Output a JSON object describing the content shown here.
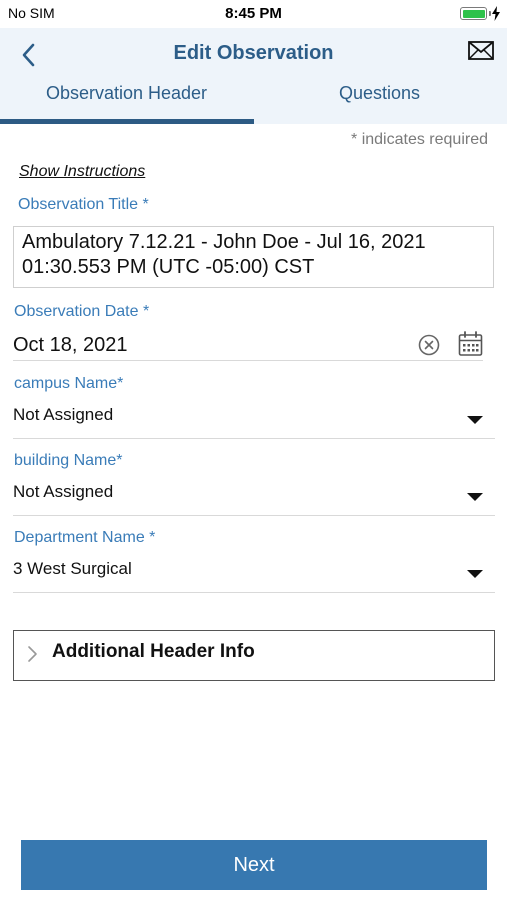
{
  "status_bar": {
    "carrier": "No SIM",
    "time": "8:45 PM",
    "battery_level": 1.0
  },
  "nav": {
    "title": "Edit Observation",
    "back_icon": "chevron-left-icon",
    "mail_icon": "envelope-icon"
  },
  "tabs": [
    {
      "label": "Observation Header",
      "active": true
    },
    {
      "label": "Questions",
      "active": false
    }
  ],
  "required_note": "* indicates required",
  "show_instructions": "Show Instructions",
  "fields": {
    "observation_title": {
      "label": "Observation Title *",
      "value": "Ambulatory 7.12.21 - John Doe - Jul 16, 2021 01:30.553 PM (UTC -05:00) CST"
    },
    "observation_date": {
      "label": "Observation Date *",
      "value": "Oct 18, 2021"
    },
    "campus_name": {
      "label": "campus Name*",
      "value": "Not Assigned"
    },
    "building_name": {
      "label": "building Name*",
      "value": "Not Assigned"
    },
    "department_name": {
      "label": "Department Name *",
      "value": "3 West Surgical"
    }
  },
  "additional_header_info": "Additional Header Info",
  "next_button": "Next",
  "colors": {
    "accent": "#3778b0",
    "nav_title": "#2c5d88",
    "label": "#3a7cb8",
    "nav_background": "#eef4fa",
    "battery": "#2ec24a"
  }
}
